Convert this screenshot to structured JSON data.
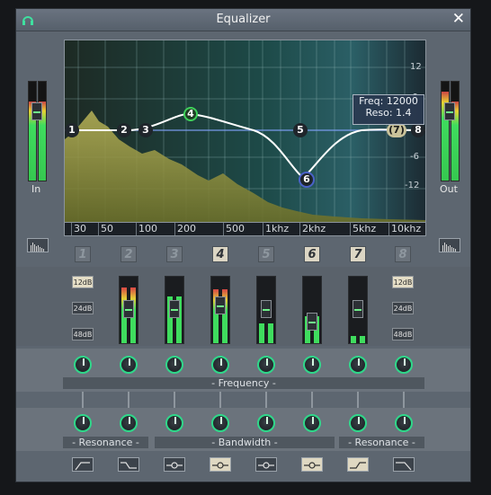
{
  "window": {
    "title": "Equalizer"
  },
  "graph": {
    "db_ticks": [
      "12",
      "6",
      "-6",
      "-12"
    ],
    "freq_ticks": [
      "30",
      "50",
      "100",
      "200",
      "500",
      "1khz",
      "2khz",
      "5khz",
      "10khz"
    ],
    "tooltip": {
      "freq": "Freq: 12000",
      "reso": "Reso: 1.4"
    },
    "nodes": [
      "1",
      "2",
      "3",
      "4",
      "5",
      "6",
      "(7)",
      "8"
    ]
  },
  "meters": {
    "in_label": "In",
    "out_label": "Out"
  },
  "bands": [
    "1",
    "2",
    "3",
    "4",
    "5",
    "6",
    "7",
    "8"
  ],
  "slope_buttons": [
    "12dB",
    "24dB",
    "48dB"
  ],
  "sections": {
    "frequency": "- Frequency -",
    "resonance": "- Resonance -",
    "bandwidth": "- Bandwidth -"
  },
  "icons": {
    "app": "equalizer-app-icon",
    "close": "close-icon",
    "analyzer": "spectrum-analyzer-icon",
    "filters": [
      "highpass-icon",
      "lowshelf-icon",
      "peak-icon",
      "peak-icon",
      "peak-icon",
      "peak-icon",
      "highshelf-icon",
      "lowpass-icon"
    ]
  },
  "colors": {
    "accent": "#2fd88a",
    "curve": "#ffffff",
    "spectrum": "#a8b050",
    "active_band": "#dcd6c4"
  }
}
